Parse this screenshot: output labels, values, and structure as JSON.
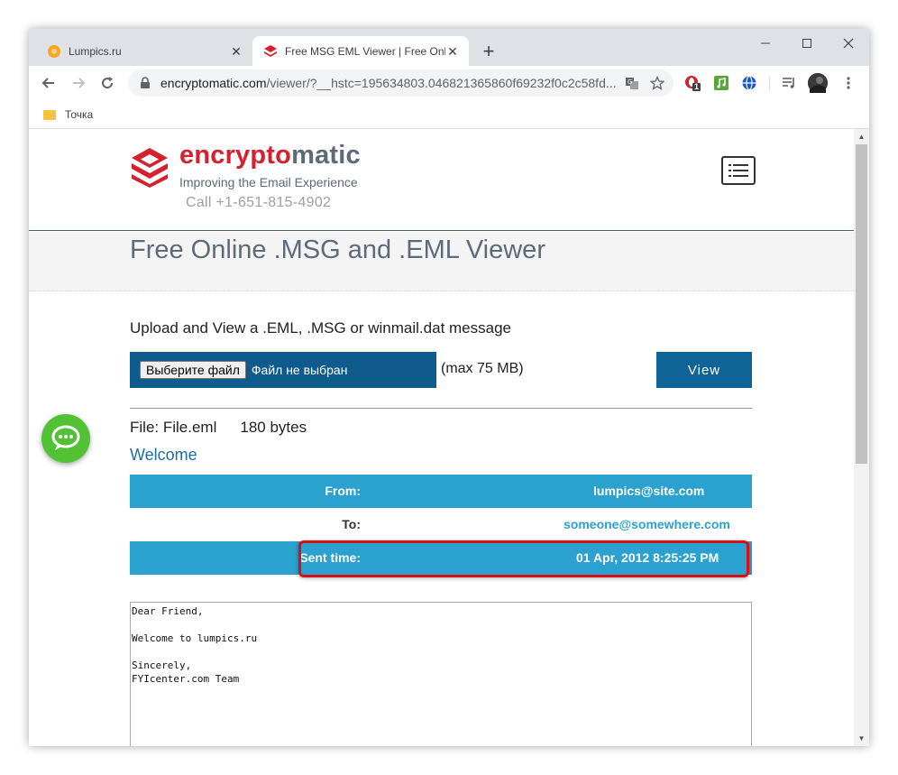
{
  "browser": {
    "tabs": [
      {
        "title": "Lumpics.ru",
        "active": false,
        "favicon": "orange-circle-icon"
      },
      {
        "title": "Free MSG EML Viewer | Free Onli",
        "active": true,
        "favicon": "encryptomatic-logo-icon"
      }
    ],
    "address": {
      "host": "encryptomatic.com",
      "path": "/viewer/?__hstc=195634803.046821365860f69232f0c2c58fd..."
    },
    "bookmarks": [
      {
        "label": "Точка"
      }
    ],
    "extension_badge": "1"
  },
  "site": {
    "brand_red": "encrypto",
    "brand_gray": "matic",
    "tagline": "Improving the Email Experience",
    "phone": "Call +1-651-815-4902",
    "page_title": "Free Online .MSG and .EML Viewer"
  },
  "upload": {
    "title": "Upload and View a .EML, .MSG or winmail.dat message",
    "choose_button": "Выберите файл",
    "file_status": "Файл не выбран",
    "max_size": "(max 75 MB)",
    "view_button": "View"
  },
  "message": {
    "file_label": "File: File.eml",
    "file_size": "180 bytes",
    "subject": "Welcome",
    "headers": [
      {
        "label": "From:",
        "value": "lumpics@site.com"
      },
      {
        "label": "To:",
        "value": "someone@somewhere.com"
      },
      {
        "label": "Sent time:",
        "value": "01 Apr, 2012 8:25:25 PM"
      }
    ],
    "body": "Dear Friend,\n\nWelcome to lumpics.ru\n\nSincerely,\nFYIcenter.com Team"
  },
  "colors": {
    "brand_red": "#d5202e",
    "header_blue": "#2aa1cf",
    "upload_bar": "#0e5b8c",
    "highlight_red": "#d80f16"
  }
}
